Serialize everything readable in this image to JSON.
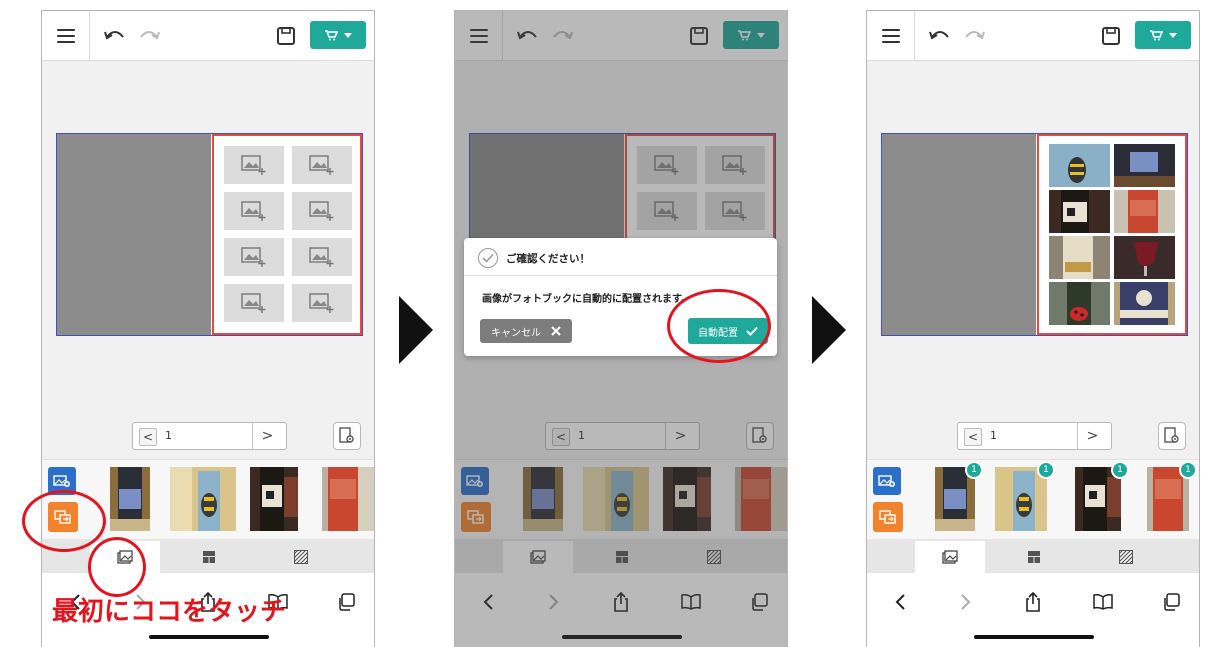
{
  "toolbar": {
    "menu_icon": "hamburger-icon",
    "undo_icon": "undo-icon",
    "redo_icon": "redo-icon",
    "save_icon": "save-icon",
    "cart_icon": "cart-icon",
    "accent_color": "#1ea99a"
  },
  "editor": {
    "page_number": "1",
    "prev_label": "<",
    "next_label": ">",
    "slot_count": 8
  },
  "dialog": {
    "title": "ご確認ください！",
    "message": "画像がフォトブックに自動的に配置されます。",
    "cancel_label": "キャンセル",
    "confirm_label": "自動配置"
  },
  "strip": {
    "used_badge": "1"
  },
  "annotation": {
    "caption": "最初にココをタッチ",
    "highlight_color": "#e3141e"
  },
  "colors": {
    "add_photo_button": "#2b6fcb",
    "auto_layout_button": "#f0832c",
    "page_border": "#3f4ec4",
    "right_page_border": "#e84a3c"
  }
}
